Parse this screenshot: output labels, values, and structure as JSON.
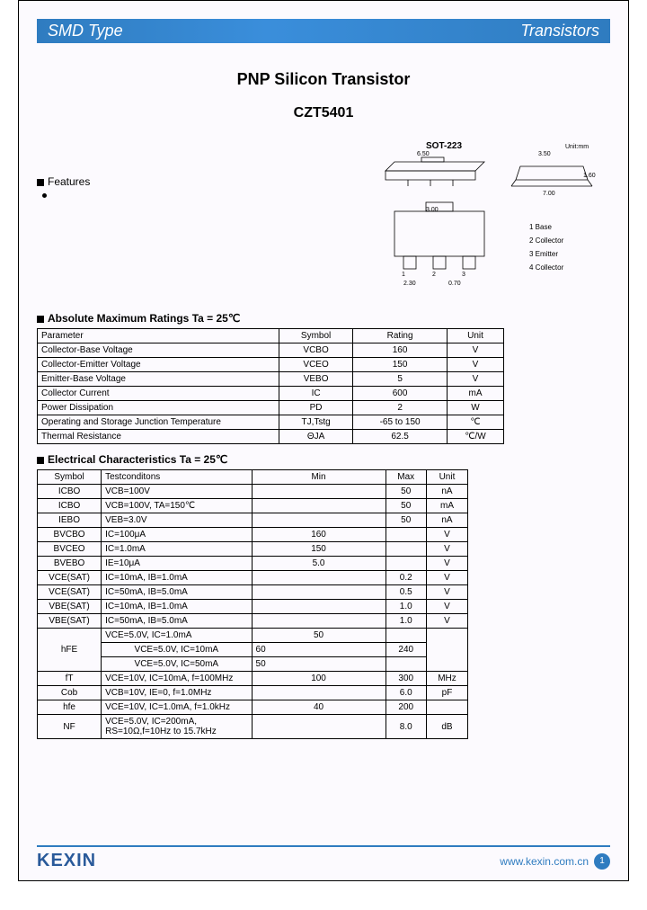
{
  "banner": {
    "left": "SMD Type",
    "right": "Transistors"
  },
  "title": "PNP  Silicon  Transistor",
  "part_number": "CZT5401",
  "features_label": "Features",
  "package": {
    "name": "SOT-223",
    "unit_label": "Unit:mm",
    "dims": {
      "w": "6.50",
      "h": "3.50",
      "pitch": "2.30",
      "lead": "0.70",
      "total": "7.00",
      "pkg_h": "1.60",
      "body_h": "3.50"
    },
    "pins": [
      "1 Base",
      "2 Collector",
      "3 Emitter",
      "4 Collector"
    ]
  },
  "amr": {
    "heading": "Absolute Maximum Ratings Ta = 25℃",
    "headers": [
      "Parameter",
      "Symbol",
      "Rating",
      "Unit"
    ],
    "rows": [
      [
        "Collector-Base Voltage",
        "VCBO",
        "160",
        "V"
      ],
      [
        "Collector-Emitter Voltage",
        "VCEO",
        "150",
        "V"
      ],
      [
        "Emitter-Base Voltage",
        "VEBO",
        "5",
        "V"
      ],
      [
        "Collector Current",
        "IC",
        "600",
        "mA"
      ],
      [
        "Power Dissipation",
        "PD",
        "2",
        "W"
      ],
      [
        "Operating and Storage Junction Temperature",
        "TJ,Tstg",
        "-65 to 150",
        "℃"
      ],
      [
        "Thermal Resistance",
        "ΘJA",
        "62.5",
        "℃/W"
      ]
    ]
  },
  "ec": {
    "heading": "Electrical Characteristics Ta = 25℃",
    "headers": [
      "Symbol",
      "Testconditons",
      "Min",
      "Max",
      "Unit"
    ],
    "rows": [
      [
        "ICBO",
        "VCB=100V",
        "",
        "50",
        "nA"
      ],
      [
        "ICBO",
        "VCB=100V, TA=150℃",
        "",
        "50",
        "mA"
      ],
      [
        "IEBO",
        "VEB=3.0V",
        "",
        "50",
        "nA"
      ],
      [
        "BVCBO",
        "IC=100μA",
        "160",
        "",
        "V"
      ],
      [
        "BVCEO",
        "IC=1.0mA",
        "150",
        "",
        "V"
      ],
      [
        "BVEBO",
        "IE=10μA",
        "5.0",
        "",
        "V"
      ],
      [
        "VCE(SAT)",
        "IC=10mA, IB=1.0mA",
        "",
        "0.2",
        "V"
      ],
      [
        "VCE(SAT)",
        "IC=50mA, IB=5.0mA",
        "",
        "0.5",
        "V"
      ],
      [
        "VBE(SAT)",
        "IC=10mA, IB=1.0mA",
        "",
        "1.0",
        "V"
      ],
      [
        "VBE(SAT)",
        "IC=50mA, IB=5.0mA",
        "",
        "1.0",
        "V"
      ]
    ],
    "hfe": {
      "symbol": "hFE",
      "conds": [
        {
          "c": "VCE=5.0V, IC=1.0mA",
          "min": "50",
          "max": ""
        },
        {
          "c": "VCE=5.0V, IC=10mA",
          "min": "60",
          "max": "240"
        },
        {
          "c": "VCE=5.0V, IC=50mA",
          "min": "50",
          "max": ""
        }
      ],
      "unit": ""
    },
    "tail": [
      [
        "fT",
        "VCE=10V, IC=10mA, f=100MHz",
        "100",
        "300",
        "MHz"
      ],
      [
        "Cob",
        "VCB=10V, IE=0, f=1.0MHz",
        "",
        "6.0",
        "pF"
      ],
      [
        "hfe",
        "VCE=10V, IC=1.0mA, f=1.0kHz",
        "40",
        "200",
        ""
      ],
      [
        "NF",
        "VCE=5.0V, IC=200mA, RS=10Ω,f=10Hz to 15.7kHz",
        "",
        "8.0",
        "dB"
      ]
    ]
  },
  "footer": {
    "brand": "KEXIN",
    "url": "www.kexin.com.cn",
    "page": "1"
  }
}
